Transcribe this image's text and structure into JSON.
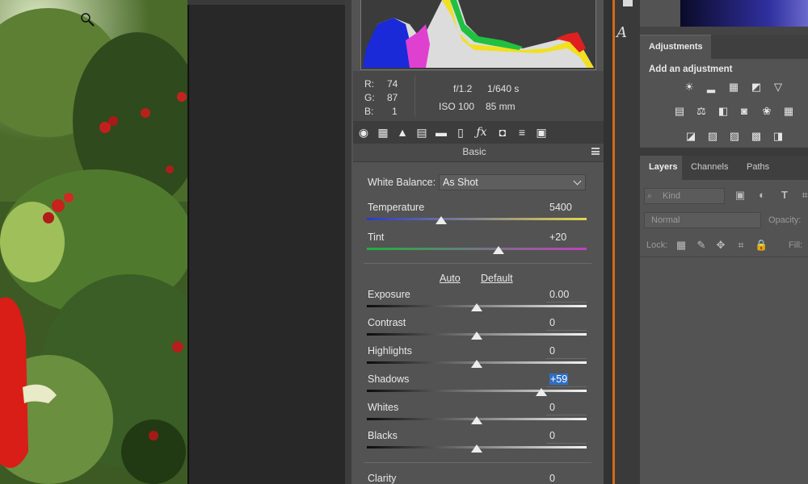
{
  "colors": {
    "accent_orange": "#d46a1a",
    "highlight_blue": "#2f6fc4"
  },
  "info": {
    "rgb": {
      "r_label": "R:",
      "r": "74",
      "g_label": "G:",
      "g": "87",
      "b_label": "B:",
      "b": "1"
    },
    "aperture": "f/1.2",
    "shutter": "1/640 s",
    "iso": "ISO 100",
    "focal": "85 mm"
  },
  "tools": [
    "basic-icon",
    "tone-curve-icon",
    "detail-icon",
    "hsl-icon",
    "split-toning-icon",
    "lens-icon",
    "fx-icon",
    "camera-calibration-icon",
    "presets-icon",
    "snapshots-icon"
  ],
  "panel": {
    "title": "Basic"
  },
  "white_balance": {
    "label": "White Balance:",
    "value": "As Shot"
  },
  "temperature": {
    "label": "Temperature",
    "value": "5400",
    "position": 0.34
  },
  "tint": {
    "label": "Tint",
    "value": "+20",
    "position": 0.6
  },
  "auto_label": "Auto",
  "default_label": "Default",
  "sliders": [
    {
      "label": "Exposure",
      "value": "0.00",
      "position": 0.5
    },
    {
      "label": "Contrast",
      "value": "0",
      "position": 0.5
    },
    {
      "label": "Highlights",
      "value": "0",
      "position": 0.5
    },
    {
      "label": "Shadows",
      "value": "+59",
      "position": 0.795
    },
    {
      "label": "Whites",
      "value": "0",
      "position": 0.5
    },
    {
      "label": "Blacks",
      "value": "0",
      "position": 0.5
    }
  ],
  "clarity": {
    "label": "Clarity",
    "value": "0"
  },
  "adjustments": {
    "tab": "Adjustments",
    "heading": "Add an adjustment"
  },
  "layers": {
    "tabs": [
      "Layers",
      "Channels",
      "Paths"
    ],
    "kind_placeholder": "Kind",
    "blend_mode": "Normal",
    "opacity_label": "Opacity:",
    "lock_label": "Lock:",
    "fill_label": "Fill:"
  },
  "mid_letter": "A"
}
